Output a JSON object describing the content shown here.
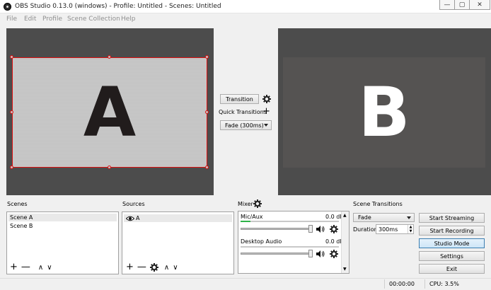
{
  "window": {
    "title": "OBS Studio 0.13.0 (windows) - Profile: Untitled - Scenes: Untitled"
  },
  "menu": [
    "File",
    "Edit",
    "Profile",
    "Scene Collection",
    "Help"
  ],
  "preview": {
    "program_letter": "A",
    "preview_letter": "B"
  },
  "transition_controls": {
    "transition_label": "Transition",
    "quick_transitions_label": "Quick Transitions",
    "fade_select_value": "Fade (300ms)"
  },
  "docks": {
    "scenes_label": "Scenes",
    "sources_label": "Sources",
    "mixer_label": "Mixer",
    "scene_transitions_label": "Scene Transitions"
  },
  "scenes": [
    "Scene A",
    "Scene B"
  ],
  "sources": [
    {
      "name": "A",
      "visible_icon": "eye-icon"
    }
  ],
  "mixer": {
    "channels": [
      {
        "name": "Mic/Aux",
        "db": "0.0 dB",
        "meter_level": 0.1
      },
      {
        "name": "Desktop Audio",
        "db": "0.0 dB",
        "meter_level": 0.0
      }
    ]
  },
  "scene_transitions": {
    "select_value": "Fade",
    "duration_label": "Duration",
    "duration_value": "300ms"
  },
  "controls": {
    "start_streaming": "Start Streaming",
    "start_recording": "Start Recording",
    "studio_mode": "Studio Mode",
    "settings": "Settings",
    "exit": "Exit"
  },
  "status": {
    "time": "00:00:00",
    "cpu": "CPU: 3.5%"
  },
  "colors": {
    "selection_red": "#dd1111",
    "meter_green": "#2fb34a",
    "studio_mode_blue": "#cde6f7"
  },
  "icons": {
    "window_min": "—",
    "window_max": "▢",
    "window_close": "✕",
    "add": "+",
    "remove": "—",
    "up": "∧",
    "down": "∨"
  }
}
